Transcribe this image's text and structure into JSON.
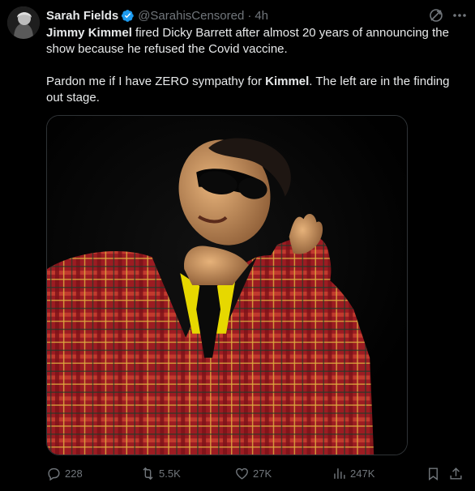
{
  "tweet": {
    "display_name": "Sarah Fields",
    "handle": "@SarahisCensored",
    "separator": "·",
    "time": "4h",
    "verified": true,
    "text": {
      "p1_bold1": "Jimmy Kimmel",
      "p1_rest": " fired Dicky Barrett after almost 20 years of announcing the show because he refused the Covid vaccine.",
      "p2_start": "Pardon me if I have ZERO sympathy for ",
      "p2_bold": "Kimmel",
      "p2_rest": ".  The left are in the finding out stage."
    }
  },
  "actions": {
    "replies": "228",
    "reposts": "5.5K",
    "likes": "27K",
    "views": "247K"
  },
  "colors": {
    "background": "#000000",
    "text": "#e7e9ea",
    "muted": "#71767b",
    "verified": "#1d9bf0"
  },
  "icons": {
    "reply": "speech-bubble-icon",
    "repost": "repost-arrows-icon",
    "like": "heart-icon",
    "views": "bar-chart-icon",
    "bookmark": "bookmark-icon",
    "share": "share-upload-icon"
  }
}
